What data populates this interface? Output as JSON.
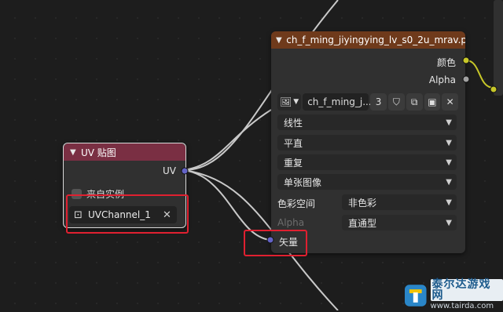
{
  "uv_node": {
    "title": "UV 贴图",
    "output": "UV",
    "from_instancer": "来自实例",
    "uv_map": "UVChannel_1"
  },
  "image_node": {
    "title": "ch_f_ming_jiyingying_lv_s0_2u_mrav.p...",
    "out_color": "颜色",
    "out_alpha": "Alpha",
    "image_name": "ch_f_ming_j...",
    "user_count": "3",
    "interpolation": "线性",
    "projection": "平直",
    "extension": "重复",
    "source": "单张图像",
    "color_space_label": "色彩空间",
    "color_space_value": "非色彩",
    "alpha_label": "Alpha",
    "alpha_value": "直通型",
    "vector_input": "矢量"
  },
  "watermark": {
    "title": "泰尔达游戏网",
    "url": "www.tairda.com"
  },
  "colors": {
    "uv_header": "#7a2f43",
    "image_header": "#6f3a1b",
    "socket_vector": "#6363c7",
    "socket_color": "#c7c729",
    "socket_float": "#a1a1a1",
    "highlight": "#e02030"
  }
}
